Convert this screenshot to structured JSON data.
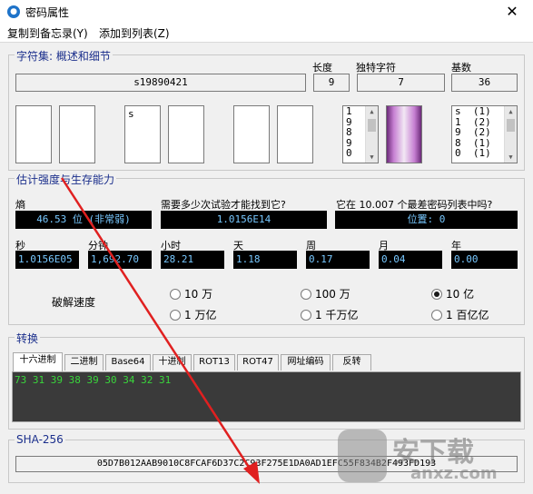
{
  "window": {
    "title": "密码属性",
    "icon": "app-icon",
    "close_glyph": "✕"
  },
  "menu": {
    "items": [
      "复制到备忘录(Y)",
      "添加到列表(Z)"
    ]
  },
  "charset": {
    "group_title": "字符集: 概述和细节",
    "password_label": "",
    "password": "s19890421",
    "length_label": "长度",
    "length": "9",
    "unique_label": "独特字符",
    "unique": "7",
    "base_label": "基数",
    "base": "36",
    "char_boxes": [
      "",
      "",
      "s",
      "",
      "",
      ""
    ],
    "chars_list": [
      "1",
      "9",
      "8",
      "9",
      "0"
    ],
    "freq_list": [
      "s  (1)",
      "1  (2)",
      "9  (2)",
      "8  (1)",
      "0  (1)"
    ]
  },
  "strength": {
    "group_title": "估计强度与生存能力",
    "entropy_label": "熵",
    "entropy_value": "46.53 位 (非常弱)",
    "tries_label": "需要多少次试验才能找到它?",
    "tries_value": "1.0156E14",
    "list_label": "它在 10.007 个最差密码列表中吗?",
    "list_value": "位置: 0",
    "time_labels": [
      "秒",
      "分钟",
      "小时",
      "天",
      "周",
      "月",
      "年"
    ],
    "time_values": [
      "1.0156E05",
      "1,692.70",
      "28.21",
      "1.18",
      "0.17",
      "0.04",
      "0.00"
    ],
    "crack_speed_label": "破解速度",
    "speeds": [
      {
        "label": "10 万",
        "selected": false
      },
      {
        "label": "100 万",
        "selected": false
      },
      {
        "label": "10 亿",
        "selected": true
      },
      {
        "label": "1 万亿",
        "selected": false
      },
      {
        "label": "1 千万亿",
        "selected": false
      },
      {
        "label": "1 百亿亿",
        "selected": false
      }
    ]
  },
  "convert": {
    "group_title": "转换",
    "tabs": [
      "十六进制",
      "二进制",
      "Base64",
      "十进制",
      "ROT13",
      "ROT47",
      "网址编码",
      "反转"
    ],
    "active_tab": 0,
    "output": "73 31 39 38 39 30 34 32 31"
  },
  "sha": {
    "group_title": "SHA-256",
    "value": "05D7B012AAB9010C8FCAF6D37C2C93F275E1DA0AD1EFC55F834B2F493FD193"
  },
  "watermark": {
    "text": "安下载",
    "sub": "anxz.com"
  },
  "colors": {
    "accent": "#1b2f8c",
    "annotation": "#e02020",
    "dark_field_bg": "#000000",
    "dark_field_text": "#78c8ff",
    "output_text": "#39d63b"
  }
}
